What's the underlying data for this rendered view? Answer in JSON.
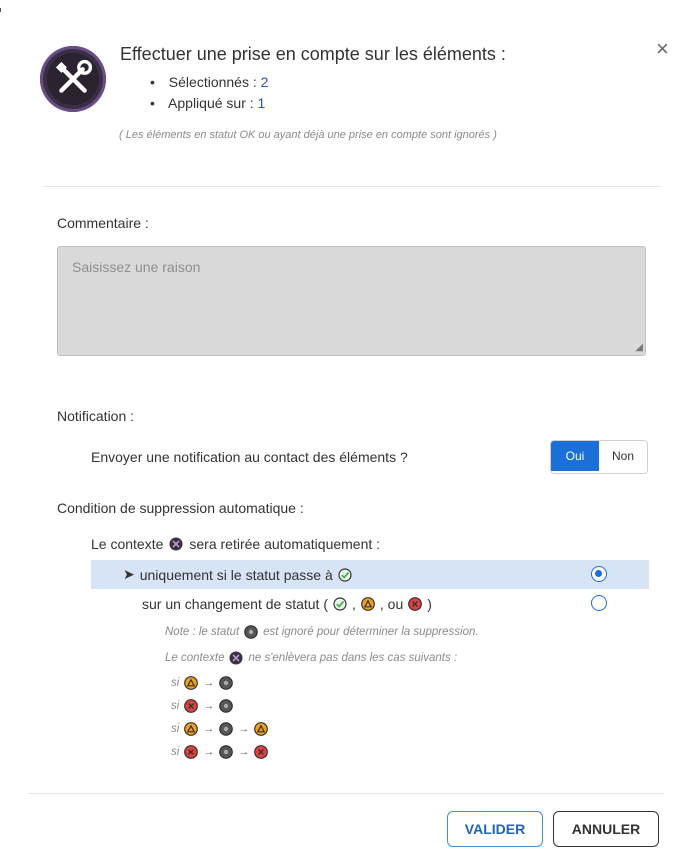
{
  "header": {
    "title": "Effectuer une prise en compte sur les éléments :",
    "selected_label": "Sélectionnés :",
    "selected_count": "2",
    "applied_label": "Appliqué sur :",
    "applied_count": "1",
    "ignored_note": "( Les éléments en statut OK ou ayant déjà une prise en compte sont ignorés )",
    "close_glyph": "×",
    "icon": "wrench-screwdriver-icon"
  },
  "comment": {
    "label": "Commentaire :",
    "placeholder": "Saisissez une raison"
  },
  "notification": {
    "label": "Notification :",
    "question": "Envoyer une notification au contact des éléments ?",
    "yes": "Oui",
    "no": "Non",
    "selected": "Oui"
  },
  "condition": {
    "label": "Condition de suppression automatique :",
    "context_prefix": "Le contexte",
    "context_suffix": "sera retirée automatiquement :",
    "option1_arrow": "➤",
    "option1": "uniquement si le statut passe à",
    "option2_prefix": "sur un changement de statut (",
    "option2_sep1": ",",
    "option2_sep2": ", ou",
    "option2_suffix": ")",
    "selected_option": 1,
    "note1_prefix": "Note : le statut",
    "note1_suffix": "est ignoré pour déterminer la suppression.",
    "note2_prefix": "Le contexte",
    "note2_suffix": "ne s'enlèvera pas dans les cas suivants :",
    "si": "si",
    "arrow": "→"
  },
  "buttons": {
    "valider": "VALIDER",
    "annuler": "ANNULER"
  },
  "colors": {
    "primary": "#1b6fd8",
    "ok": "#4caf50",
    "warning": "#f0a020",
    "critical": "#e04040",
    "unknown": "#8a8a8a",
    "context": "#6a4c86"
  }
}
